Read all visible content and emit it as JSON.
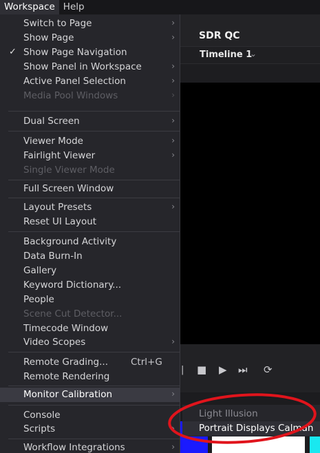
{
  "menubar": {
    "items": [
      {
        "label": "Workspace"
      },
      {
        "label": "Help"
      }
    ]
  },
  "app": {
    "title": "SDR QC",
    "timeline_label": "Timeline 1",
    "timeline_chevron": "⌄"
  },
  "menu": {
    "items": [
      {
        "label": "Switch to Page",
        "chevron": "›",
        "state": "normal"
      },
      {
        "label": "Show Page",
        "chevron": "›",
        "state": "normal"
      },
      {
        "label": "Show Page Navigation",
        "check": "✓",
        "state": "normal"
      },
      {
        "label": "Show Panel in Workspace",
        "chevron": "›",
        "state": "normal"
      },
      {
        "label": "Active Panel Selection",
        "chevron": "›",
        "state": "normal"
      },
      {
        "label": "Media Pool Windows",
        "chevron": "›",
        "state": "disabled"
      },
      {
        "label": "Dual Screen",
        "chevron": "›",
        "state": "normal"
      },
      {
        "label": "Viewer Mode",
        "chevron": "›",
        "state": "normal"
      },
      {
        "label": "Fairlight Viewer",
        "chevron": "›",
        "state": "normal"
      },
      {
        "label": "Single Viewer Mode",
        "state": "disabled"
      },
      {
        "label": "Full Screen Window",
        "state": "normal"
      },
      {
        "label": "Layout Presets",
        "chevron": "›",
        "state": "normal"
      },
      {
        "label": "Reset UI Layout",
        "state": "normal"
      },
      {
        "label": "Background Activity",
        "state": "normal"
      },
      {
        "label": "Data Burn-In",
        "state": "normal"
      },
      {
        "label": "Gallery",
        "state": "normal"
      },
      {
        "label": "Keyword Dictionary...",
        "state": "normal"
      },
      {
        "label": "People",
        "state": "normal"
      },
      {
        "label": "Scene Cut Detector...",
        "state": "disabled"
      },
      {
        "label": "Timecode Window",
        "state": "normal"
      },
      {
        "label": "Video Scopes",
        "chevron": "›",
        "state": "normal"
      },
      {
        "label": "Remote Grading...",
        "shortcut": "Ctrl+G",
        "state": "normal"
      },
      {
        "label": "Remote Rendering",
        "state": "normal"
      },
      {
        "label": "Monitor Calibration",
        "chevron": "›",
        "state": "highlight"
      },
      {
        "label": "Console",
        "state": "normal"
      },
      {
        "label": "Scripts",
        "chevron": "›",
        "state": "normal"
      },
      {
        "label": "Workflow Integrations",
        "chevron": "›",
        "state": "normal"
      }
    ]
  },
  "submenu": {
    "items": [
      {
        "label": "Light Illusion",
        "state": "dim"
      },
      {
        "label": "Portrait Displays Calman",
        "state": "highlight"
      }
    ]
  },
  "annotation": {
    "color": "#e0141c"
  },
  "swatches": {
    "blue": "#1a1aff",
    "white": "#ffffff",
    "cyan": "#19e8f0"
  }
}
